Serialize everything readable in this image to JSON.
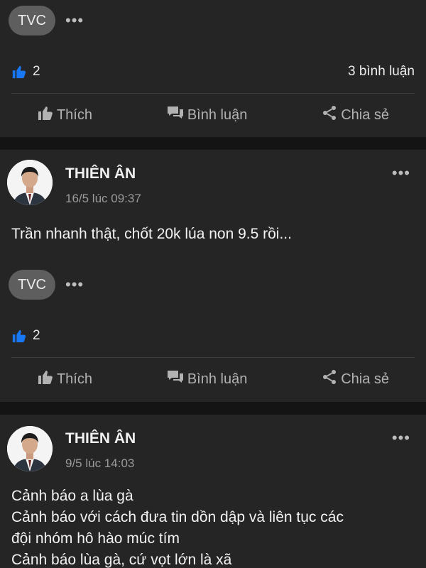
{
  "colors": {
    "background": "#141414",
    "card": "#252525",
    "like_blue": "#1877f2",
    "tvc_badge": "#5e5e5e"
  },
  "actions": {
    "like": "Thích",
    "comment": "Bình luận",
    "share": "Chia sẻ"
  },
  "posts": [
    {
      "tvc_label": "TVC",
      "like_count": "2",
      "comment_count": "3 bình luận"
    },
    {
      "author": "THIÊN ÂN",
      "time": "16/5 lúc 09:37",
      "body": [
        "Trần nhanh thật, chốt 20k lúa non 9.5 rồi..."
      ],
      "tvc_label": "TVC",
      "like_count": "2"
    },
    {
      "author": "THIÊN ÂN",
      "time": "9/5 lúc 14:03",
      "body": [
        "Cảnh báo a lùa gà",
        "Cảnh báo với cách đưa tin dồn dập và liên tục các",
        "đội nhóm hô hào múc tím",
        "Cảnh báo lùa gà, cứ vọt lớn là xã"
      ]
    }
  ]
}
